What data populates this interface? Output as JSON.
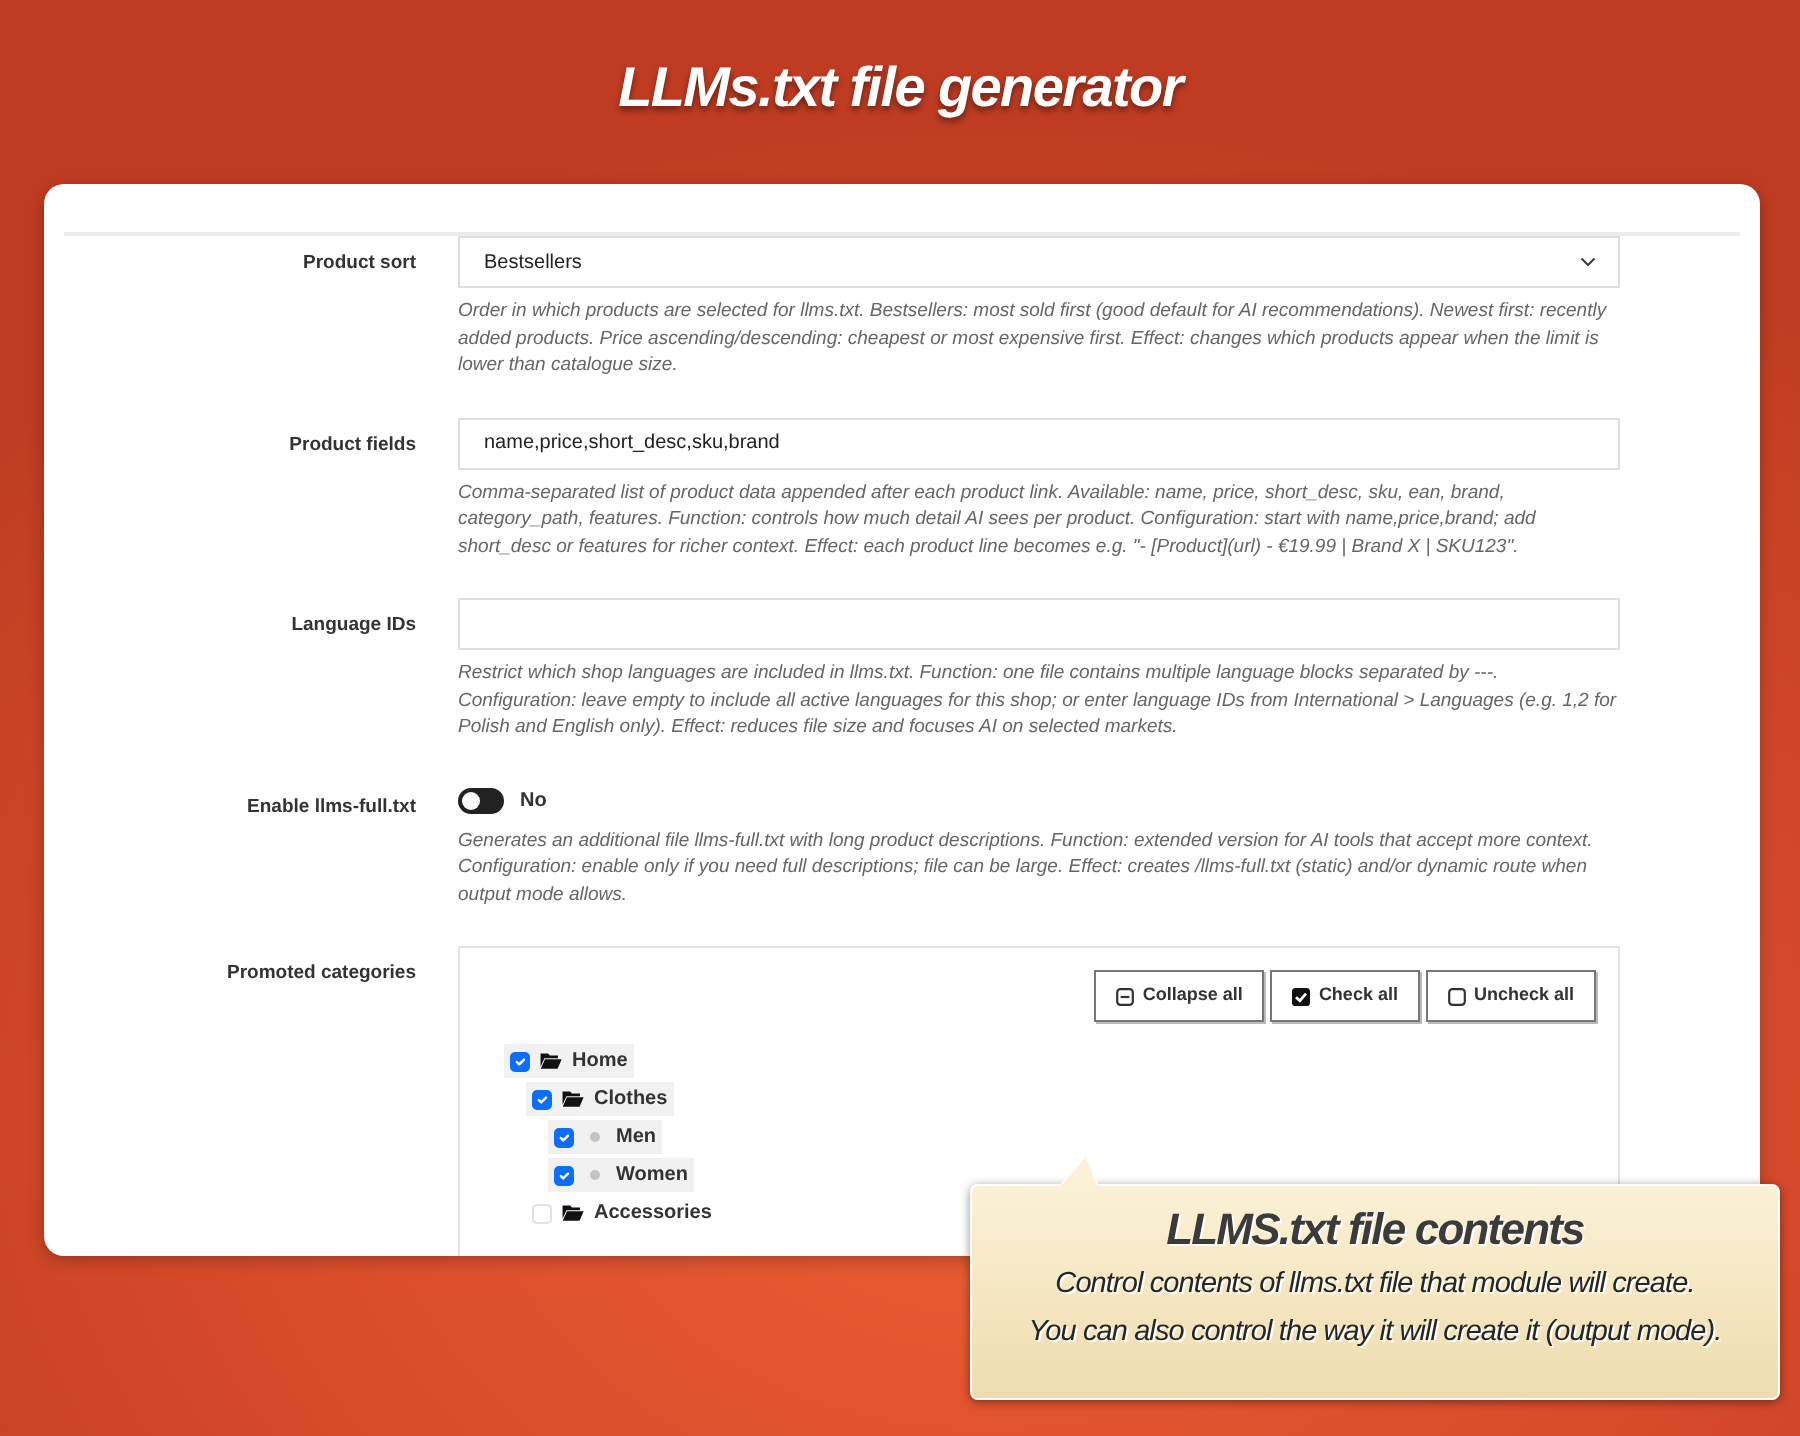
{
  "header": {
    "title": "LLMs.txt file generator"
  },
  "settings": [
    {
      "kind": "select",
      "label": "Product sort",
      "value": "Bestsellers",
      "help": "Order in which products are selected for llms.txt. Bestsellers: most sold first (good default for AI recommendations). Newest first: recently added products. Price ascending/descending: cheapest or most expensive first. Effect: changes which products appear when the limit is lower than catalogue size."
    },
    {
      "kind": "text",
      "label": "Product fields",
      "value": "name,price,short_desc,sku,brand",
      "help": "Comma-separated list of product data appended after each product link. Available: name, price, short_desc, sku, ean, brand, category_path, features. Function: controls how much detail AI sees per product. Configuration: start with name,price,brand; add short_desc or features for richer context. Effect: each product line becomes e.g. \"- [Product](url) - €19.99 | Brand X | SKU123\"."
    },
    {
      "kind": "text",
      "label": "Language IDs",
      "help": "Restrict which shop languages are included in llms.txt. Function: one file contains multiple language blocks separated by ---.\nConfiguration: leave empty to include all active languages for this shop; or enter language IDs from International > Languages (e.g. 1,2 for Polish and English only). Effect: reduces file size and focuses AI on selected markets."
    },
    {
      "kind": "switch",
      "label": "Enable llms-full.txt",
      "on": false,
      "state_text": "No",
      "help": "Generates an additional file llms-full.txt with long product descriptions. Function: extended version for AI tools that accept more context.\nConfiguration: enable only if you need full descriptions; file can be large. Effect: creates /llms-full.txt (static) and/or dynamic route when output mode allows."
    },
    {
      "kind": "tree",
      "label": "Promoted categories",
      "buttons": [
        {
          "kind": "collapse",
          "label": "Collapse all"
        },
        {
          "kind": "check",
          "label": "Check all"
        },
        {
          "kind": "uncheck",
          "label": "Uncheck all"
        }
      ],
      "tree": [
        {
          "label": "Home",
          "kind": "folder",
          "checked": true,
          "children": [
            {
              "label": "Clothes",
              "kind": "folder",
              "checked": true,
              "children": [
                {
                  "label": "Men",
                  "kind": "leaf",
                  "checked": true
                },
                {
                  "label": "Women",
                  "kind": "leaf",
                  "checked": true
                }
              ]
            },
            {
              "label": "Accessories",
              "kind": "folder",
              "checked": false
            }
          ]
        }
      ]
    }
  ],
  "callout": {
    "title": "LLMS.txt file contents",
    "lines": [
      "Control contents of llms.txt file that module will create.",
      "You can also control the way it will create it (output mode)."
    ]
  }
}
